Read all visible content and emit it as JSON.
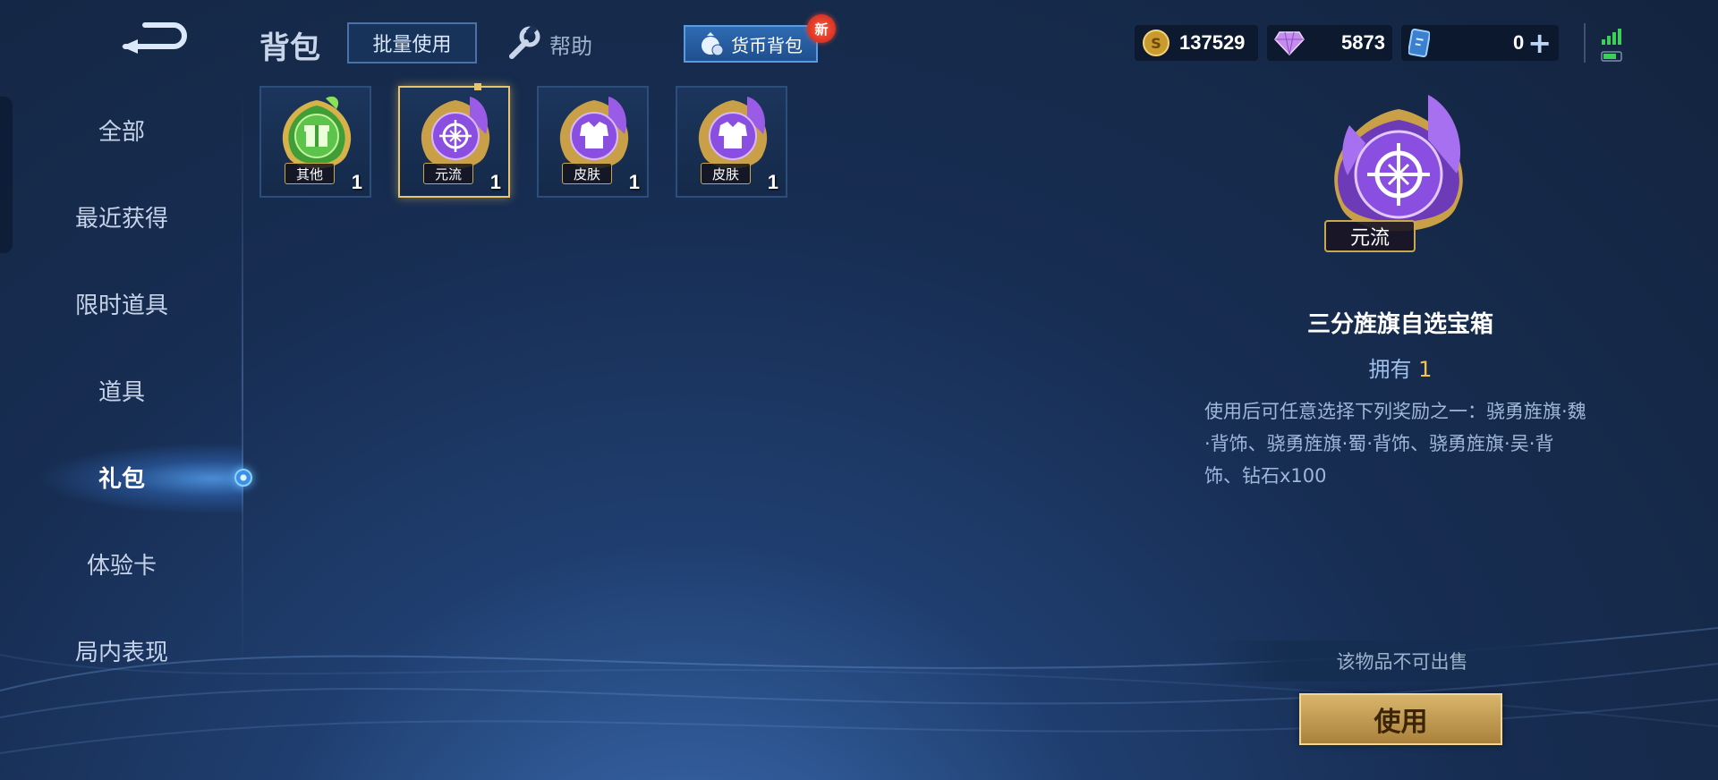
{
  "header": {
    "title": "背包",
    "batch_use_label": "批量使用",
    "help_label": "帮助",
    "currency_bag_label": "货币背包",
    "new_badge": "新"
  },
  "resources": {
    "gold": "137529",
    "gems": "5873",
    "cards": "0"
  },
  "sidebar": {
    "items": [
      {
        "label": "全部"
      },
      {
        "label": "最近获得"
      },
      {
        "label": "限时道具"
      },
      {
        "label": "道具"
      },
      {
        "label": "礼包",
        "active": true
      },
      {
        "label": "体验卡"
      },
      {
        "label": "局内表现"
      }
    ]
  },
  "items": [
    {
      "tag": "其他",
      "count": "1",
      "color": "#4fae3a"
    },
    {
      "tag": "元流",
      "count": "1",
      "color": "#8a4fe0",
      "selected": true
    },
    {
      "tag": "皮肤",
      "count": "1",
      "color": "#8a4fe0"
    },
    {
      "tag": "皮肤",
      "count": "1",
      "color": "#8a4fe0"
    }
  ],
  "detail": {
    "tag": "元流",
    "name": "三分旌旗自选宝箱",
    "own_label": "拥有",
    "own_count": "1",
    "description": "使用后可任意选择下列奖励之一：骁勇旌旗·魏·背饰、骁勇旌旗·蜀·背饰、骁勇旌旗·吴·背饰、钻石x100",
    "no_sell": "该物品不可出售",
    "use_label": "使用"
  },
  "colors": {
    "accent_gold": "#f2c44d",
    "selected_border": "#e8c46a",
    "button_gold": "#d9b56b"
  }
}
